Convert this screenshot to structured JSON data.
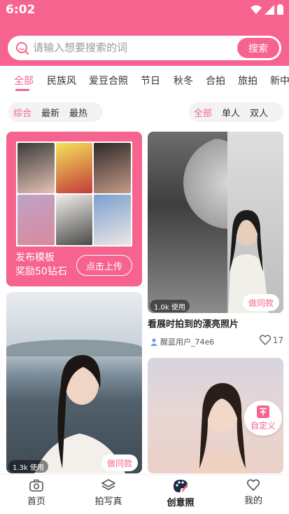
{
  "status": {
    "time": "6:02"
  },
  "search": {
    "placeholder": "请输入想要搜索的词",
    "button": "搜索"
  },
  "categories": [
    {
      "label": "全部",
      "active": true
    },
    {
      "label": "民族风"
    },
    {
      "label": "爱豆合照"
    },
    {
      "label": "节日"
    },
    {
      "label": "秋冬"
    },
    {
      "label": "合拍"
    },
    {
      "label": "旅拍"
    },
    {
      "label": "新中"
    }
  ],
  "sort_filters": [
    {
      "label": "综合",
      "active": true
    },
    {
      "label": "最新"
    },
    {
      "label": "最热"
    }
  ],
  "people_filters": [
    {
      "label": "全部",
      "active": true
    },
    {
      "label": "单人"
    },
    {
      "label": "双人"
    }
  ],
  "promo": {
    "line1": "发布模板",
    "line2": "奖励50钻石",
    "button": "点击上传"
  },
  "cards": [
    {
      "usage": "1.0k 使用",
      "same_button": "做同款",
      "title": "看展时拍到的漂亮照片",
      "user": "醒蓝用户_74e6",
      "likes": "17"
    },
    {
      "usage": "1.3k 使用",
      "same_button": "做同款"
    }
  ],
  "custom_button": {
    "label": "自定义"
  },
  "bottom_nav": [
    {
      "label": "首页",
      "icon": "camera-icon"
    },
    {
      "label": "拍写真",
      "icon": "layers-icon"
    },
    {
      "label": "创意照",
      "icon": "palette-icon",
      "active": true
    },
    {
      "label": "我的",
      "icon": "heart-icon"
    }
  ],
  "colors": {
    "accent": "#f7638f"
  }
}
